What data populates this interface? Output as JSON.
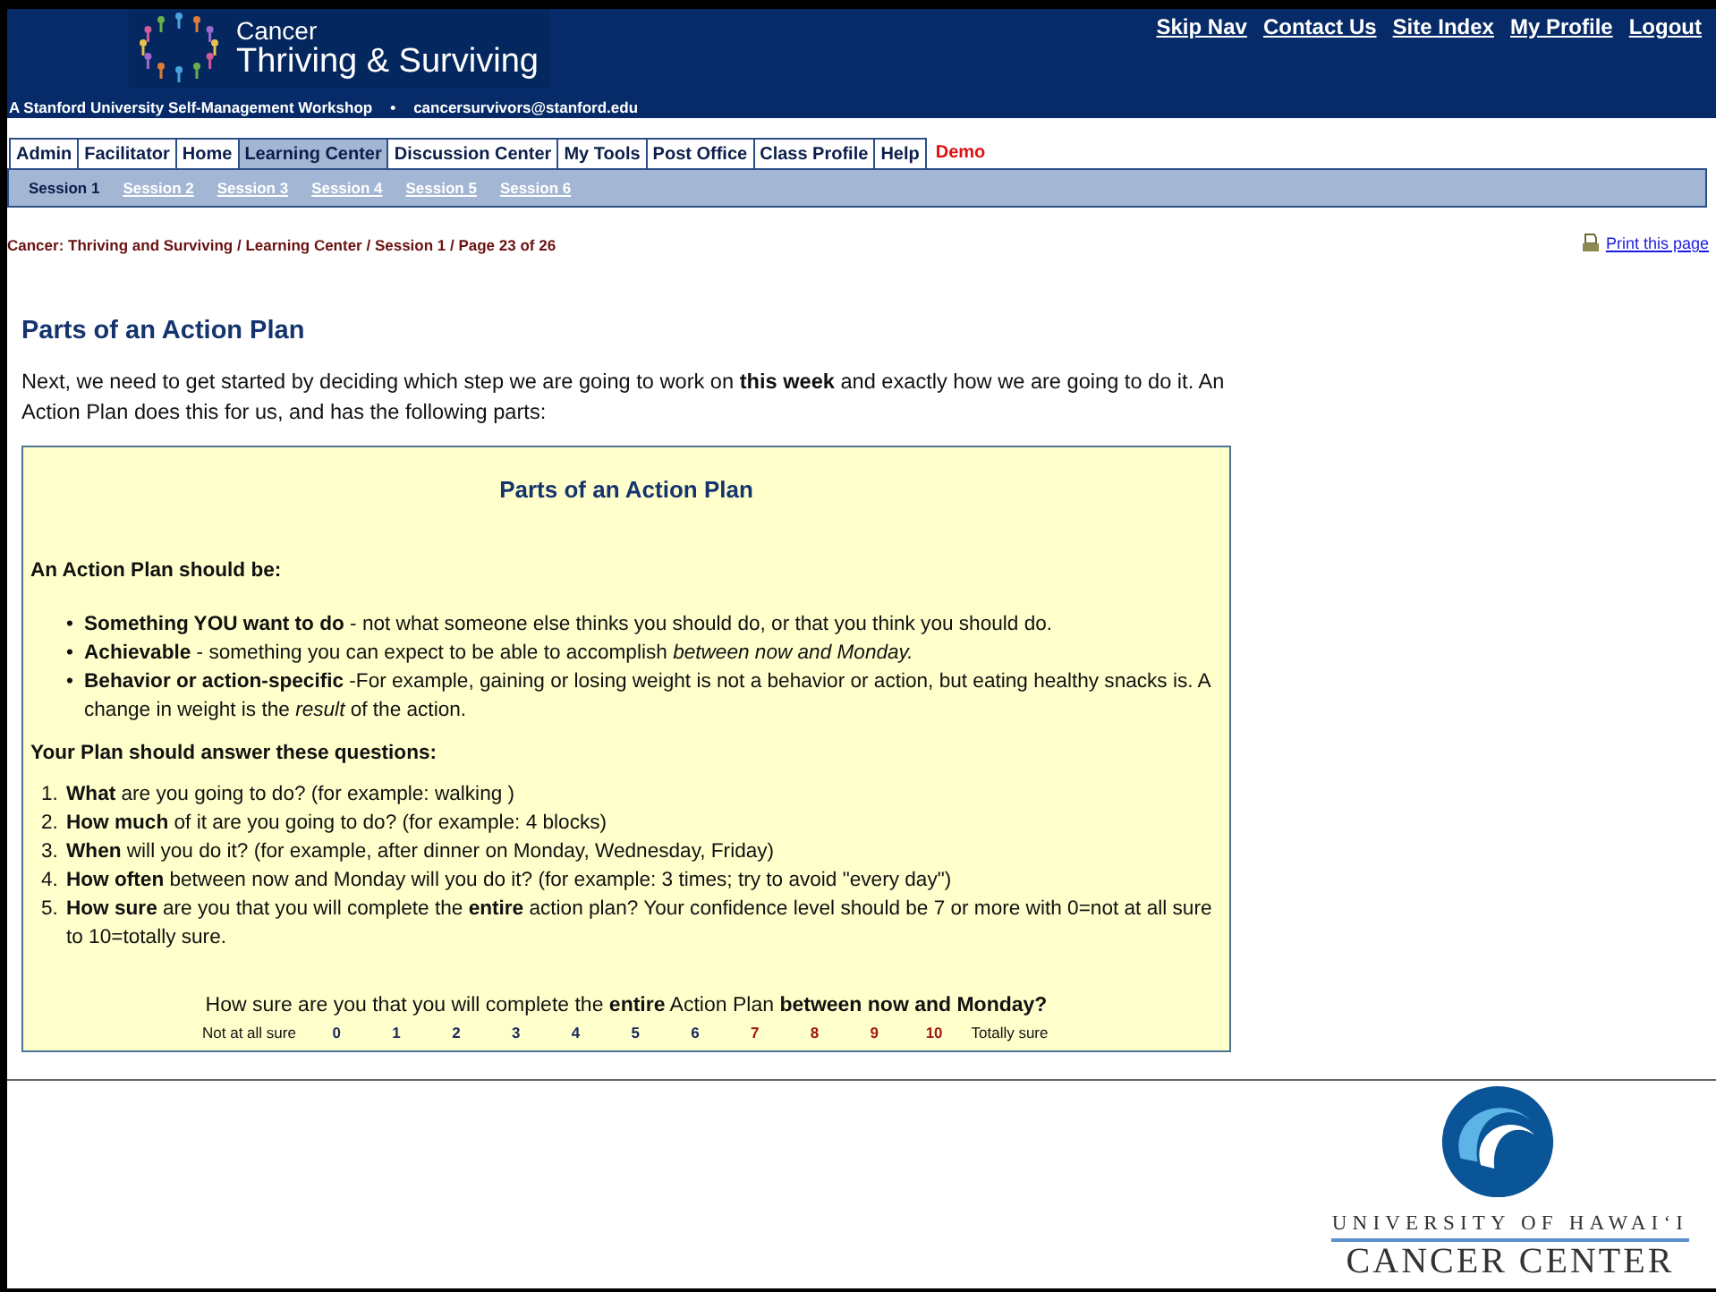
{
  "header": {
    "logo_small": "Cancer",
    "logo_title": "Thriving & Surviving",
    "tagline": "A Stanford University Self-Management Workshop",
    "separator": "•",
    "email": "cancersurvivors@stanford.edu",
    "top_links": [
      "Skip Nav",
      "Contact Us",
      "Site Index",
      "My Profile",
      "Logout"
    ]
  },
  "tabs": [
    {
      "label": "Admin",
      "selected": false
    },
    {
      "label": "Facilitator",
      "selected": false
    },
    {
      "label": "Home",
      "selected": false
    },
    {
      "label": "Learning Center",
      "selected": true
    },
    {
      "label": "Discussion Center",
      "selected": false
    },
    {
      "label": "My Tools",
      "selected": false
    },
    {
      "label": "Post Office",
      "selected": false
    },
    {
      "label": "Class Profile",
      "selected": false
    },
    {
      "label": "Help",
      "selected": false
    }
  ],
  "demo_label": "Demo",
  "sessions": [
    {
      "label": "Session 1",
      "selected": true
    },
    {
      "label": "Session 2",
      "selected": false
    },
    {
      "label": "Session 3",
      "selected": false
    },
    {
      "label": "Session 4",
      "selected": false
    },
    {
      "label": "Session 5",
      "selected": false
    },
    {
      "label": "Session 6",
      "selected": false
    }
  ],
  "breadcrumb": "Cancer: Thriving and Surviving / Learning Center / Session 1 / Page 23 of 26",
  "print_link": "Print this page",
  "heading": "Parts of an Action Plan",
  "intro": "Next, we need to get started by deciding which step we are going to work on **this week** and exactly how we are going to do it. An Action Plan does this for us, and has the following parts:",
  "box": {
    "title": "Parts of an Action Plan",
    "should_be_heading": "An Action Plan should be:",
    "bullets": [
      {
        "marker": "•",
        "text": "**Something YOU want to do** - not what someone else thinks you should do, or that you think you should do."
      },
      {
        "marker": "•",
        "text": "**Achievable** - something you can expect to be able to accomplish *between now and Monday.*"
      },
      {
        "marker": "•",
        "text": "**Behavior or action-specific** -For example, gaining or losing weight is not a behavior or action, but eating healthy snacks is. A change in weight is the *result* of the action."
      }
    ],
    "questions_heading": "Your Plan should answer these questions:",
    "questions": [
      {
        "number": "1.",
        "text": "**What** are you going to do? (for example: walking )"
      },
      {
        "number": "2.",
        "text": "**How much** of it are you going to do? (for example: 4 blocks)"
      },
      {
        "number": "3.",
        "text": "**When** will you do it? (for example, after dinner on Monday, Wednesday, Friday)"
      },
      {
        "number": "4.",
        "text": "**How often** between now and Monday will you do it? (for example: 3 times; try to avoid \"every day\")"
      },
      {
        "number": "5.",
        "text": "**How sure** are you that you will complete the **entire** action plan? Your confidence level should be 7 or more with 0=not at all sure to 10=totally sure."
      }
    ],
    "scale": {
      "question": "How sure are you that you will complete the **entire** Action Plan **between now and Monday?**",
      "low_label": "Not at all sure",
      "high_label": "Totally sure",
      "values": [
        {
          "label": "0",
          "color": "#1a2a5e"
        },
        {
          "label": "1",
          "color": "#1a2a5e"
        },
        {
          "label": "2",
          "color": "#1a2a5e"
        },
        {
          "label": "3",
          "color": "#1a2a5e"
        },
        {
          "label": "4",
          "color": "#1a2a5e"
        },
        {
          "label": "5",
          "color": "#1a2a5e"
        },
        {
          "label": "6",
          "color": "#1a2a5e"
        },
        {
          "label": "7",
          "color": "#a01818"
        },
        {
          "label": "8",
          "color": "#a01818"
        },
        {
          "label": "9",
          "color": "#a01818"
        },
        {
          "label": "10",
          "color": "#a01818"
        }
      ]
    }
  },
  "footer": {
    "university": "UNIVERSITY OF HAWAI‘I",
    "center": "CANCER CENTER"
  }
}
